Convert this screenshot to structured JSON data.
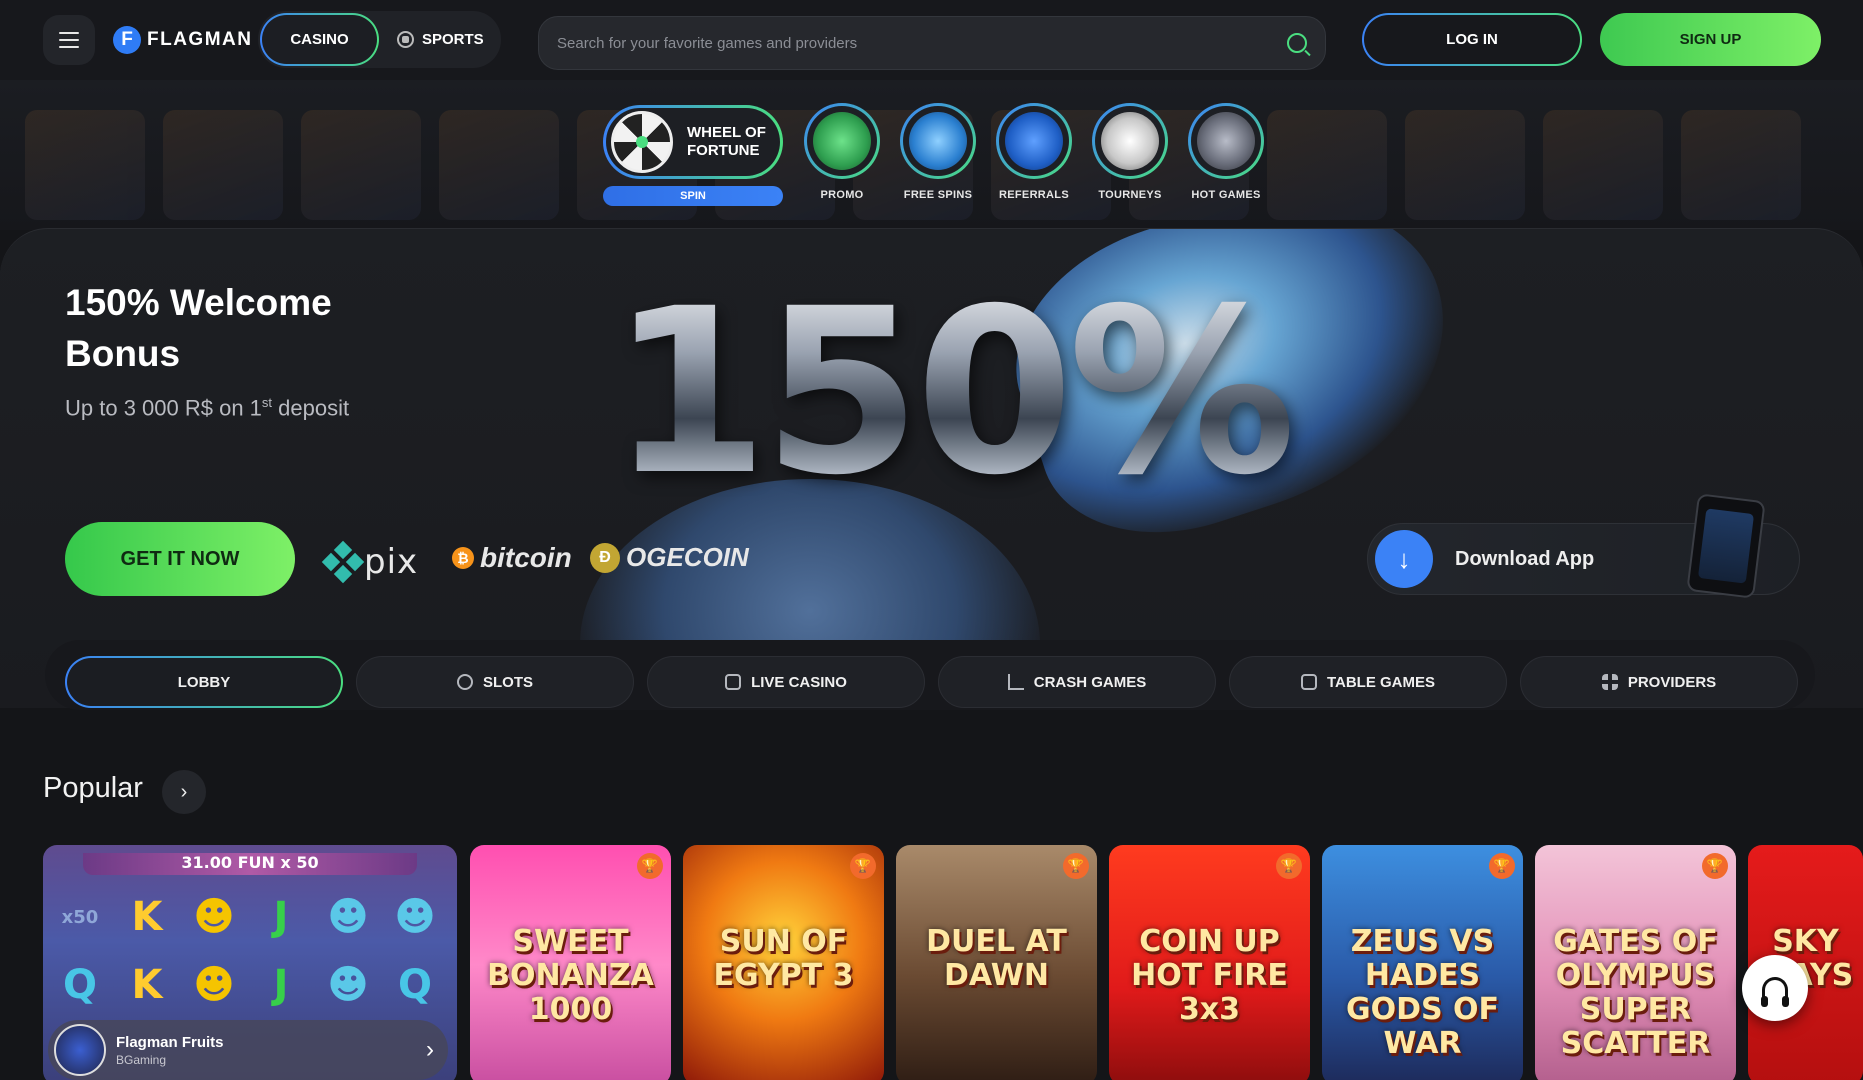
{
  "header": {
    "logo_letter": "F",
    "logo_text": "FLAGMAN",
    "mode_casino": "CASINO",
    "mode_sports": "SPORTS",
    "search_placeholder": "Search for your favorite games and providers",
    "login": "LOG IN",
    "signup": "SIGN UP"
  },
  "quick_links": {
    "wheel_label": "WHEEL OF FORTUNE",
    "spin": "SPIN",
    "items": [
      {
        "label": "PROMO",
        "icon": "piggy-bank-icon",
        "color": "#2e9e4f"
      },
      {
        "label": "FREE SPINS",
        "icon": "ticket-icon",
        "color": "#2a7fd0"
      },
      {
        "label": "REFERRALS",
        "icon": "money-bag-icon",
        "color": "#1f5fc6"
      },
      {
        "label": "TOURNEYS",
        "icon": "trophy-icon",
        "color": "#c8c8c8"
      },
      {
        "label": "HOT GAMES",
        "icon": "rocket-icon",
        "color": "#6b6f7c"
      }
    ]
  },
  "hero": {
    "title": "150% Welcome Bonus",
    "subtitle_pre": "Up to 3 000 R$ on 1",
    "subtitle_sup": "st",
    "subtitle_post": " deposit",
    "big_number": "150%",
    "cta": "GET IT NOW",
    "payments": {
      "pix": "pix",
      "bitcoin_symbol": "₿",
      "bitcoin": "bitcoin",
      "doge_symbol": "Ð",
      "doge": "OGECOIN"
    },
    "download_icon": "↓",
    "download": "Download App"
  },
  "tabs": [
    {
      "label": "LOBBY",
      "icon": ""
    },
    {
      "label": "SLOTS",
      "icon": "cherry-icon"
    },
    {
      "label": "LIVE CASINO",
      "icon": "live-casino-icon"
    },
    {
      "label": "CRASH GAMES",
      "icon": "chart-up-icon"
    },
    {
      "label": "TABLE GAMES",
      "icon": "dice-icon"
    },
    {
      "label": "PROVIDERS",
      "icon": "grid-icon"
    }
  ],
  "popular": {
    "title": "Popular",
    "arrow": "›",
    "featured": {
      "banner": "31.00 FUN x 50",
      "symbols": [
        "x50",
        "K",
        "☻",
        "J",
        "☻",
        "☻",
        "Q",
        "K",
        "☻",
        "J",
        "☻",
        "Q"
      ],
      "name": "Flagman Fruits",
      "provider": "BGaming",
      "arrow": "›"
    },
    "games": [
      {
        "title": "SWEET BONANZA 1000",
        "trophy": "🏆",
        "bg": "linear-gradient(180deg,#ff4fb0,#ff89c9 50%,#c84ea0)"
      },
      {
        "title": "SUN OF EGYPT 3",
        "trophy": "🏆",
        "bg": "radial-gradient(circle at 50% 40%,#ffd23a,#f07a12 45%,#8c1608)"
      },
      {
        "title": "DUEL AT DAWN",
        "trophy": "🏆",
        "bg": "linear-gradient(180deg,#a98a6a,#6a4a32 55%,#2e1d14)"
      },
      {
        "title": "COIN UP HOT FIRE 3x3",
        "trophy": "🏆",
        "bg": "linear-gradient(180deg,#ff3b1f,#e01a1a 60%,#8d0d0d)"
      },
      {
        "title": "ZEUS VS HADES GODS OF WAR",
        "trophy": "🏆",
        "bg": "linear-gradient(180deg,#3d8fe0,#2a5aa8 55%,#1d2a5a)"
      },
      {
        "title": "GATES OF OLYMPUS SUPER SCATTER",
        "trophy": "🏆",
        "bg": "linear-gradient(180deg,#f3c4d8,#e28fb7 55%,#b35f8d)"
      },
      {
        "title": "SKY WAYS",
        "trophy": "",
        "bg": "linear-gradient(180deg,#e51b1b,#b40f0f)"
      }
    ]
  }
}
